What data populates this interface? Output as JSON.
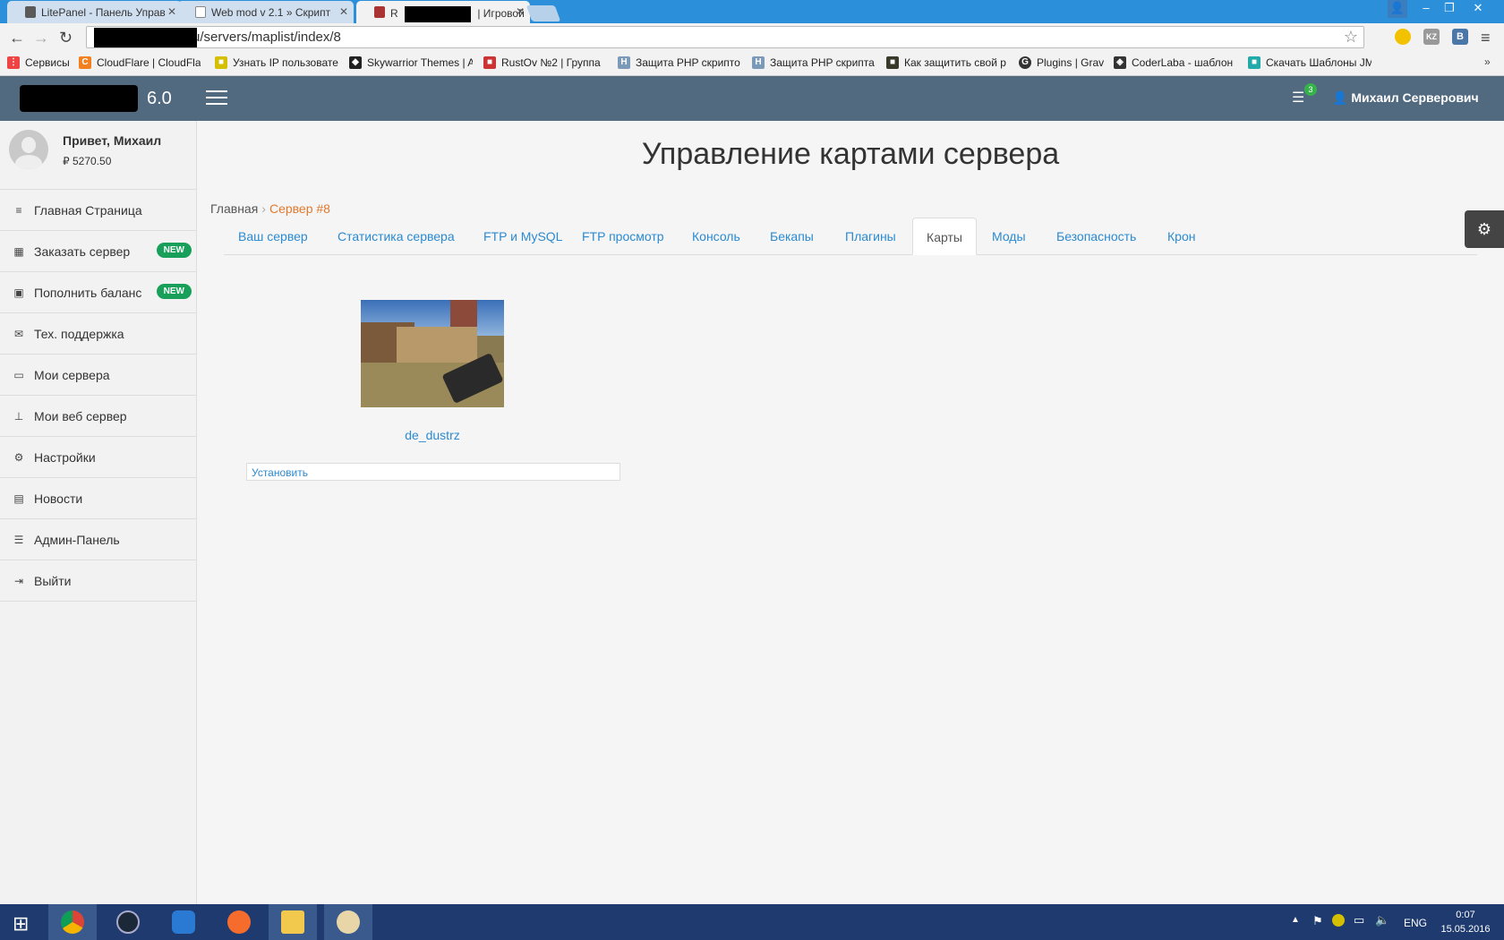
{
  "browser": {
    "tabs": [
      {
        "title": "LitePanel - Панель Управ",
        "active": false
      },
      {
        "title": "Web mod v 2.1 » Скрипт",
        "active": false
      },
      {
        "title": "R",
        "title_suffix": "| Игровой",
        "active": true
      }
    ],
    "url": "u/servers/maplist/index/8",
    "bookmarks": [
      "Сервисы",
      "CloudFlare | CloudFla",
      "Узнать IP пользовате",
      "Skywarrior Themes | A",
      "RustOv №2 | Группа",
      "Защита PHP скрипто",
      "Защита PHP скрипта",
      "Как защитить свой р",
      "Plugins | Grav",
      "CoderLaba - шаблон",
      "Скачать Шаблоны JM"
    ],
    "extensions": [
      "",
      "KZ",
      "В"
    ]
  },
  "header": {
    "version": "6.0",
    "notifications_count": "3",
    "user_name": "Михаил Серверович"
  },
  "sidebar": {
    "greeting": "Привет, Михаил",
    "balance": "5270.50",
    "currency_symbol": "₽",
    "items": [
      {
        "label": "Главная Страница",
        "icon": "align-left-icon",
        "badge": ""
      },
      {
        "label": "Заказать сервер",
        "icon": "grid-icon",
        "badge": "NEW"
      },
      {
        "label": "Пополнить баланс",
        "icon": "money-icon",
        "badge": "NEW"
      },
      {
        "label": "Тех. поддержка",
        "icon": "envelope-icon",
        "badge": ""
      },
      {
        "label": "Мои сервера",
        "icon": "laptop-icon",
        "badge": ""
      },
      {
        "label": "Мои веб сервер",
        "icon": "sitemap-icon",
        "badge": ""
      },
      {
        "label": "Настройки",
        "icon": "gears-icon",
        "badge": ""
      },
      {
        "label": "Новости",
        "icon": "calendar-icon",
        "badge": ""
      },
      {
        "label": "Админ-Панель",
        "icon": "list-icon",
        "badge": ""
      },
      {
        "label": "Выйти",
        "icon": "sign-out-icon",
        "badge": ""
      }
    ]
  },
  "main": {
    "title": "Управление картами сервера",
    "breadcrumb": {
      "home": "Главная",
      "current": "Сервер #8"
    },
    "tabs": [
      {
        "label": "Ваш сервер",
        "active": false
      },
      {
        "label": "Статистика сервера",
        "active": false
      },
      {
        "label": "FTP и MySQL",
        "active": false
      },
      {
        "label": "FTP просмотр",
        "active": false
      },
      {
        "label": "Консоль",
        "active": false
      },
      {
        "label": "Бекапы",
        "active": false
      },
      {
        "label": "Плагины",
        "active": false
      },
      {
        "label": "Карты",
        "active": true
      },
      {
        "label": "Моды",
        "active": false
      },
      {
        "label": "Безопасность",
        "active": false
      },
      {
        "label": "Крон",
        "active": false
      }
    ],
    "map": {
      "name": "de_dustrz",
      "install_label": "Установить"
    }
  },
  "taskbar": {
    "lang": "ENG",
    "time": "0:07",
    "date": "15.05.2016"
  },
  "colors": {
    "header_bg": "#516a80",
    "link": "#2b8ad1",
    "breadcrumb_current": "#e07a2e",
    "badge_new": "#18a05a"
  }
}
